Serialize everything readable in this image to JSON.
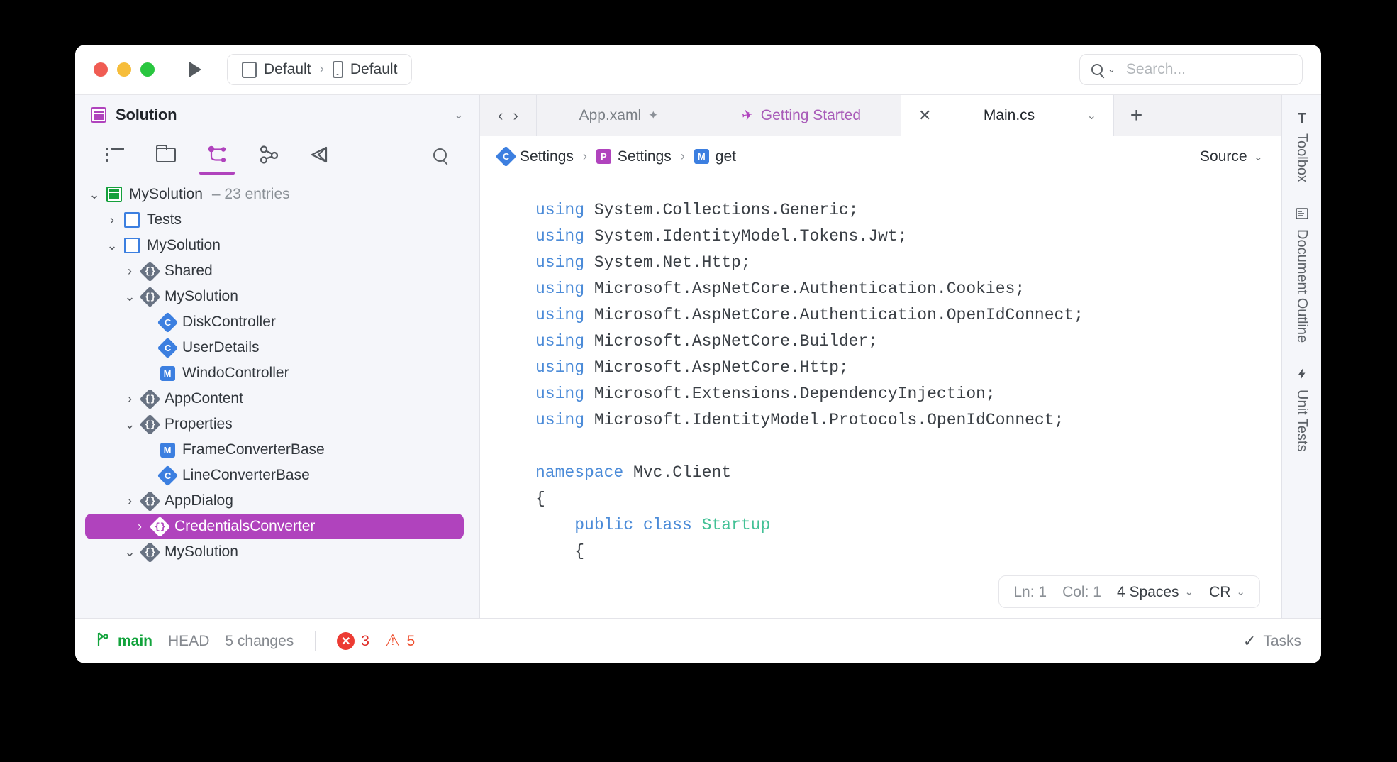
{
  "titlebar": {
    "run_config": {
      "primary": "Default",
      "secondary": "Default",
      "separator": "›"
    },
    "search": {
      "placeholder": "Search...",
      "icon": "search-icon"
    }
  },
  "sidebar": {
    "header": {
      "title": "Solution",
      "icon": "solution-icon",
      "collapse_icon": "⌄"
    },
    "tools": [
      {
        "name": "list-view-icon",
        "active": false
      },
      {
        "name": "folder-view-icon",
        "active": false
      },
      {
        "name": "structure-view-icon",
        "active": true
      },
      {
        "name": "connected-services-icon",
        "active": false
      },
      {
        "name": "unity-icon",
        "active": false
      }
    ],
    "search_icon": "search-icon",
    "tree": [
      {
        "indent": 0,
        "twisty": "⌄",
        "icon": "solution-green",
        "glyph": "",
        "label": "MySolution",
        "sub": "– 23 entries",
        "selected": false
      },
      {
        "indent": 1,
        "twisty": "›",
        "icon": "project-blue",
        "glyph": "",
        "label": "Tests",
        "sub": "",
        "selected": false
      },
      {
        "indent": 1,
        "twisty": "⌄",
        "icon": "project-blue",
        "glyph": "",
        "label": "MySolution",
        "sub": "",
        "selected": false
      },
      {
        "indent": 2,
        "twisty": "›",
        "icon": "namespace-gray",
        "glyph": "{}",
        "label": "Shared",
        "sub": "",
        "selected": false
      },
      {
        "indent": 2,
        "twisty": "⌄",
        "icon": "namespace-gray",
        "glyph": "{}",
        "label": "MySolution",
        "sub": "",
        "selected": false
      },
      {
        "indent": 3,
        "twisty": "",
        "icon": "class-blue",
        "glyph": "C",
        "label": "DiskController",
        "sub": "",
        "selected": false
      },
      {
        "indent": 3,
        "twisty": "",
        "icon": "class-blue",
        "glyph": "C",
        "label": "UserDetails",
        "sub": "",
        "selected": false
      },
      {
        "indent": 3,
        "twisty": "",
        "icon": "method-blue",
        "glyph": "M",
        "label": "WindoController",
        "sub": "",
        "selected": false
      },
      {
        "indent": 2,
        "twisty": "›",
        "icon": "namespace-gray",
        "glyph": "{}",
        "label": "AppContent",
        "sub": "",
        "selected": false
      },
      {
        "indent": 2,
        "twisty": "⌄",
        "icon": "namespace-gray",
        "glyph": "{}",
        "label": "Properties",
        "sub": "",
        "selected": false
      },
      {
        "indent": 3,
        "twisty": "",
        "icon": "method-blue",
        "glyph": "M",
        "label": "FrameConverterBase",
        "sub": "",
        "selected": false
      },
      {
        "indent": 3,
        "twisty": "",
        "icon": "class-blue",
        "glyph": "C",
        "label": "LineConverterBase",
        "sub": "",
        "selected": false
      },
      {
        "indent": 2,
        "twisty": "›",
        "icon": "namespace-gray",
        "glyph": "{}",
        "label": "AppDialog",
        "sub": "",
        "selected": false
      },
      {
        "indent": 2,
        "twisty": "›",
        "icon": "namespace-gray",
        "glyph": "{}",
        "label": "CredentialsConverter",
        "sub": "",
        "selected": true
      },
      {
        "indent": 2,
        "twisty": "⌄",
        "icon": "namespace-gray",
        "glyph": "{}",
        "label": "MySolution",
        "sub": "",
        "selected": false
      }
    ]
  },
  "editor": {
    "nav": {
      "back": "‹",
      "forward": "›"
    },
    "tabs": [
      {
        "label": "App.xaml",
        "pinned": true,
        "pin_glyph": "✦",
        "active": false,
        "kind": "file"
      },
      {
        "label": "Getting Started",
        "active": false,
        "kind": "welcome",
        "icon": "rocket-icon",
        "icon_glyph": "✈"
      },
      {
        "label": "Main.cs",
        "active": true,
        "kind": "file",
        "close_glyph": "✕",
        "caret_glyph": "⌄"
      }
    ],
    "add_tab_glyph": "+",
    "breadcrumb": [
      {
        "icon": "class-blue",
        "glyph": "C",
        "label": "Settings"
      },
      {
        "icon": "property-purple",
        "glyph": "P",
        "label": "Settings"
      },
      {
        "icon": "method-blue",
        "glyph": "M",
        "label": "get"
      }
    ],
    "breadcrumb_sep": "›",
    "source_selector": {
      "label": "Source",
      "caret": "⌄"
    },
    "code_lines": [
      [
        {
          "t": "using ",
          "c": "kw"
        },
        {
          "t": "System.Collections.Generic;",
          "c": ""
        }
      ],
      [
        {
          "t": "using ",
          "c": "kw"
        },
        {
          "t": "System.IdentityModel.Tokens.Jwt;",
          "c": ""
        }
      ],
      [
        {
          "t": "using ",
          "c": "kw"
        },
        {
          "t": "System.Net.Http;",
          "c": ""
        }
      ],
      [
        {
          "t": "using ",
          "c": "kw"
        },
        {
          "t": "Microsoft.AspNetCore.Authentication.Cookies;",
          "c": ""
        }
      ],
      [
        {
          "t": "using ",
          "c": "kw"
        },
        {
          "t": "Microsoft.AspNetCore.Authentication.OpenIdConnect;",
          "c": ""
        }
      ],
      [
        {
          "t": "using ",
          "c": "kw"
        },
        {
          "t": "Microsoft.AspNetCore.Builder;",
          "c": ""
        }
      ],
      [
        {
          "t": "using ",
          "c": "kw"
        },
        {
          "t": "Microsoft.AspNetCore.Http;",
          "c": ""
        }
      ],
      [
        {
          "t": "using ",
          "c": "kw"
        },
        {
          "t": "Microsoft.Extensions.DependencyInjection;",
          "c": ""
        }
      ],
      [
        {
          "t": "using ",
          "c": "kw"
        },
        {
          "t": "Microsoft.IdentityModel.Protocols.OpenIdConnect;",
          "c": ""
        }
      ],
      [
        {
          "t": "",
          "c": ""
        }
      ],
      [
        {
          "t": "namespace ",
          "c": "kw"
        },
        {
          "t": "Mvc.Client",
          "c": ""
        }
      ],
      [
        {
          "t": "{",
          "c": ""
        }
      ],
      [
        {
          "t": "    public class ",
          "c": "kw"
        },
        {
          "t": "Startup",
          "c": "type"
        }
      ],
      [
        {
          "t": "    {",
          "c": ""
        }
      ]
    ],
    "status": {
      "line_label": "Ln: 1",
      "col_label": "Col: 1",
      "indent": "4 Spaces",
      "indent_caret": "⌄",
      "eol": "CR",
      "eol_caret": "⌄"
    }
  },
  "rail": [
    {
      "label": "Toolbox",
      "icon": "hammer-icon",
      "glyph": "⚒"
    },
    {
      "label": "Document Outline",
      "icon": "document-outline-icon",
      "glyph": "▤"
    },
    {
      "label": "Unit Tests",
      "icon": "lightning-icon",
      "glyph": "⚡"
    }
  ],
  "statusbar": {
    "branch_icon": "git-branch-icon",
    "branch": "main",
    "head": "HEAD",
    "changes": "5 changes",
    "errors": {
      "count": "3",
      "glyph": "✕"
    },
    "warnings": {
      "count": "5",
      "glyph": "⚠"
    },
    "tasks": {
      "label": "Tasks",
      "check": "✓"
    }
  },
  "colors": {
    "accent_purple": "#b043bd",
    "blue": "#3c7fe0",
    "green": "#15a03c",
    "error_red": "#ec3b33",
    "warn_orange": "#ee4f2e",
    "sidebar_bg": "#f5f6fa"
  }
}
